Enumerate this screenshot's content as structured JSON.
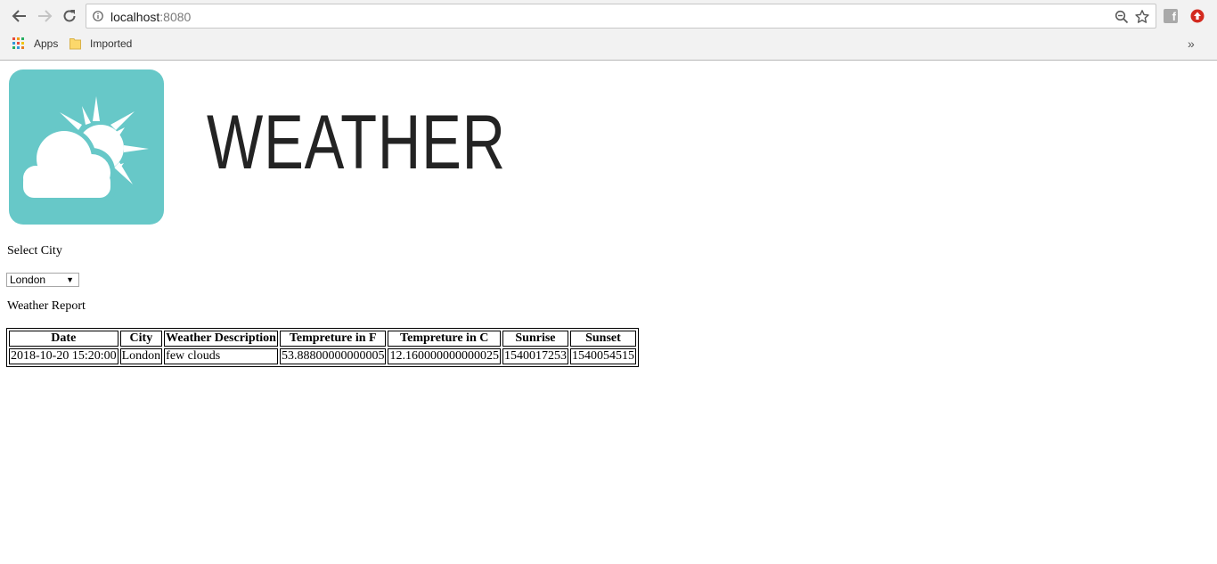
{
  "browser": {
    "url_host": "localhost",
    "url_port": ":8080",
    "bookmarks": {
      "apps_label": "Apps",
      "imported_label": "Imported",
      "more_label": "»"
    }
  },
  "header": {
    "wordmark": "WEATHER"
  },
  "form": {
    "select_label": "Select City",
    "selected_city": "London"
  },
  "report": {
    "title": "Weather Report",
    "columns": [
      "Date",
      "City",
      "Weather Description",
      "Tempreture in F",
      "Tempreture in C",
      "Sunrise",
      "Sunset"
    ],
    "rows": [
      [
        "2018-10-20 15:20:00",
        "London",
        "few clouds",
        "53.88800000000005",
        "12.160000000000025",
        "1540017253",
        "1540054515"
      ]
    ]
  },
  "colors": {
    "logo_bg": "#67c8c8",
    "logo_fg": "#ffffff"
  }
}
